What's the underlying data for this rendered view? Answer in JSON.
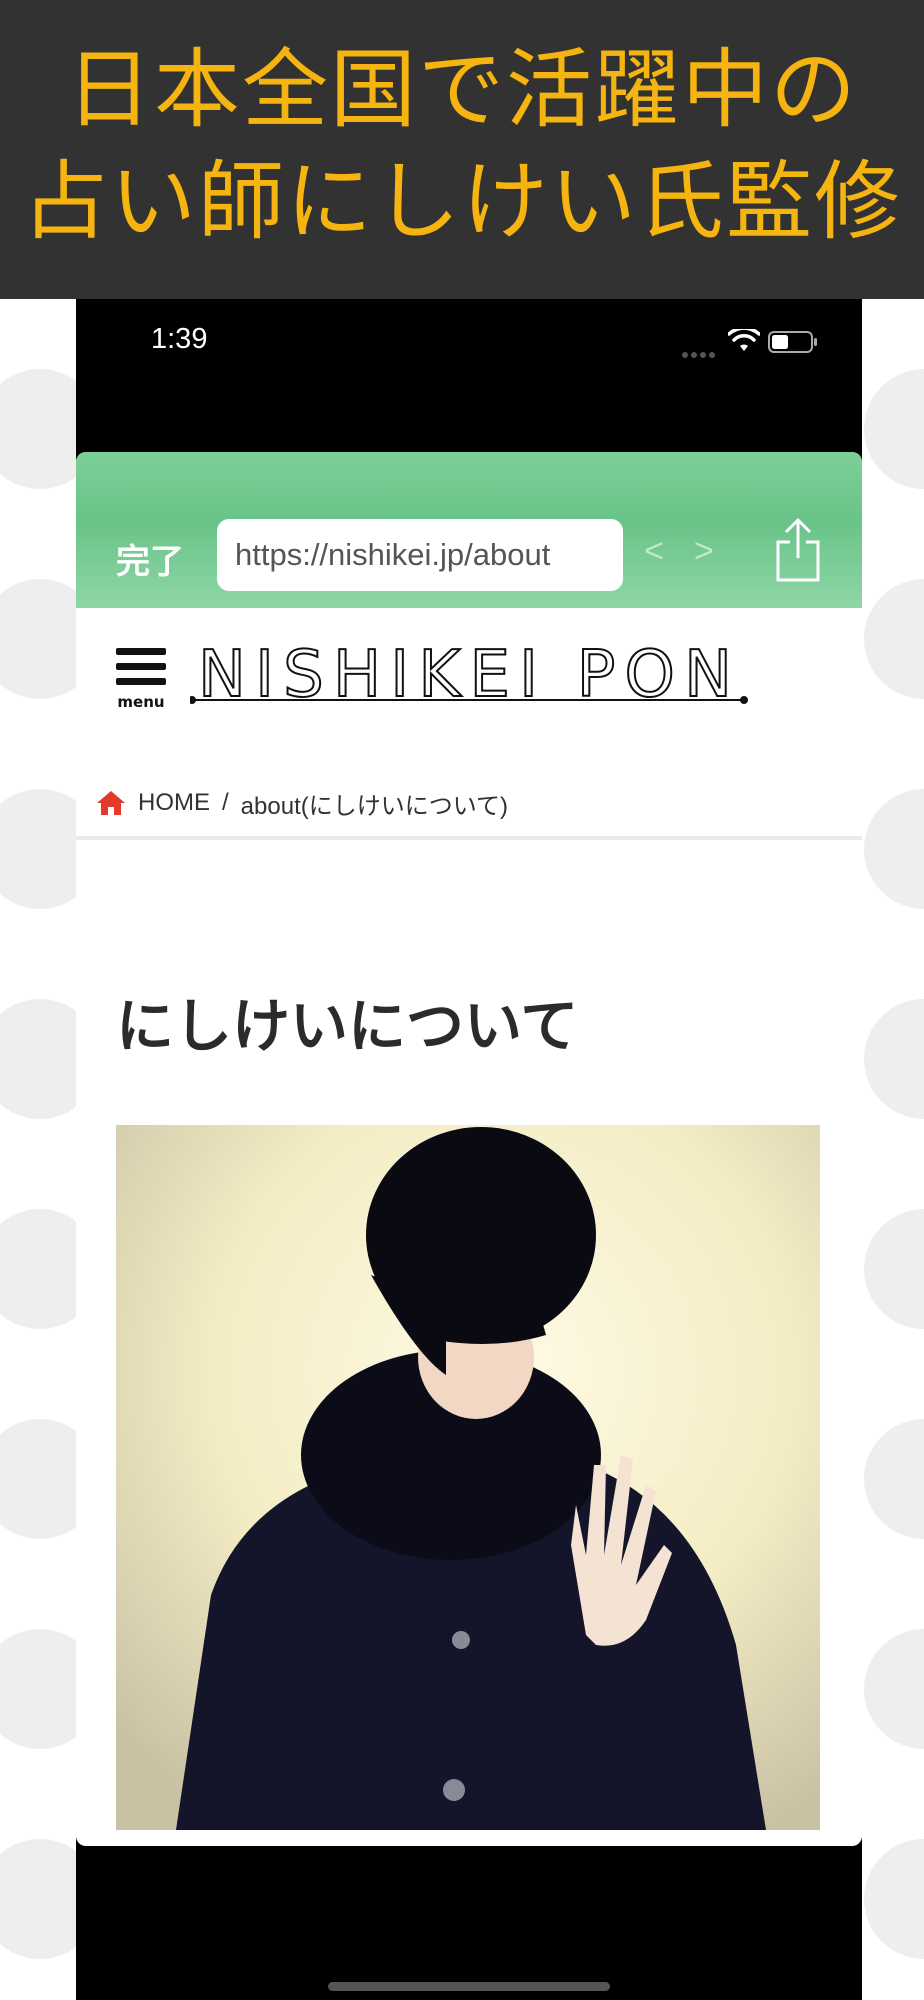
{
  "banner": {
    "line1": "日本全国で活躍中の",
    "line2": "占い師にしけい氏監修"
  },
  "status_bar": {
    "time": "1:39"
  },
  "browser": {
    "done_label": "完了",
    "url": "https://nishikei.jp/about",
    "back_icon": "<",
    "forward_icon": ">"
  },
  "site": {
    "menu_label": "menu",
    "logo_text": "NISHIKEI PON"
  },
  "breadcrumb": {
    "home": "HOME",
    "separator": "/",
    "current": "about(にしけいについて)"
  },
  "page": {
    "title": "にしけいについて"
  },
  "colors": {
    "banner_bg": "#323232",
    "banner_text": "#f5b40f",
    "browser_bar": "#6ec68c",
    "home_icon": "#e23b2c"
  }
}
